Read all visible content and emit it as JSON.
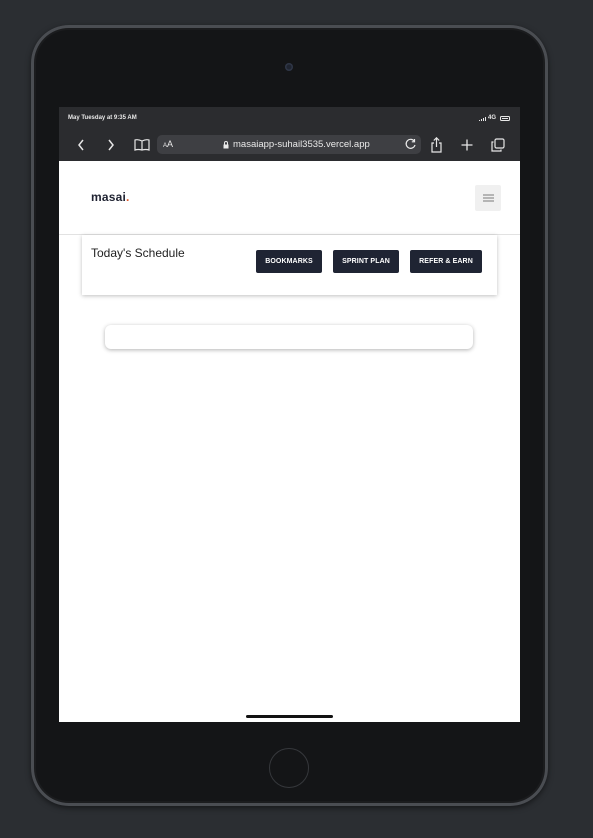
{
  "status_bar": {
    "time": "May Tuesday at 9:35 AM",
    "network": "4G"
  },
  "browser": {
    "text_size_label_small": "A",
    "text_size_label_large": "A",
    "url": "masaiapp-suhail3535.vercel.app",
    "icons": [
      "back-icon",
      "forward-icon",
      "bookmarks-book-icon",
      "lock-icon",
      "reload-icon",
      "share-icon",
      "new-tab-plus-icon",
      "tabs-icon"
    ]
  },
  "header": {
    "logo_text": "masai",
    "logo_dot": ".",
    "accent_color": "#e05a2a"
  },
  "schedule": {
    "title": "Today's Schedule",
    "buttons": {
      "bookmarks": "BOOKMARKS",
      "sprint_plan": "SPRINT PLAN",
      "refer_earn": "REFER & EARN"
    },
    "button_color": "#1f2433"
  }
}
